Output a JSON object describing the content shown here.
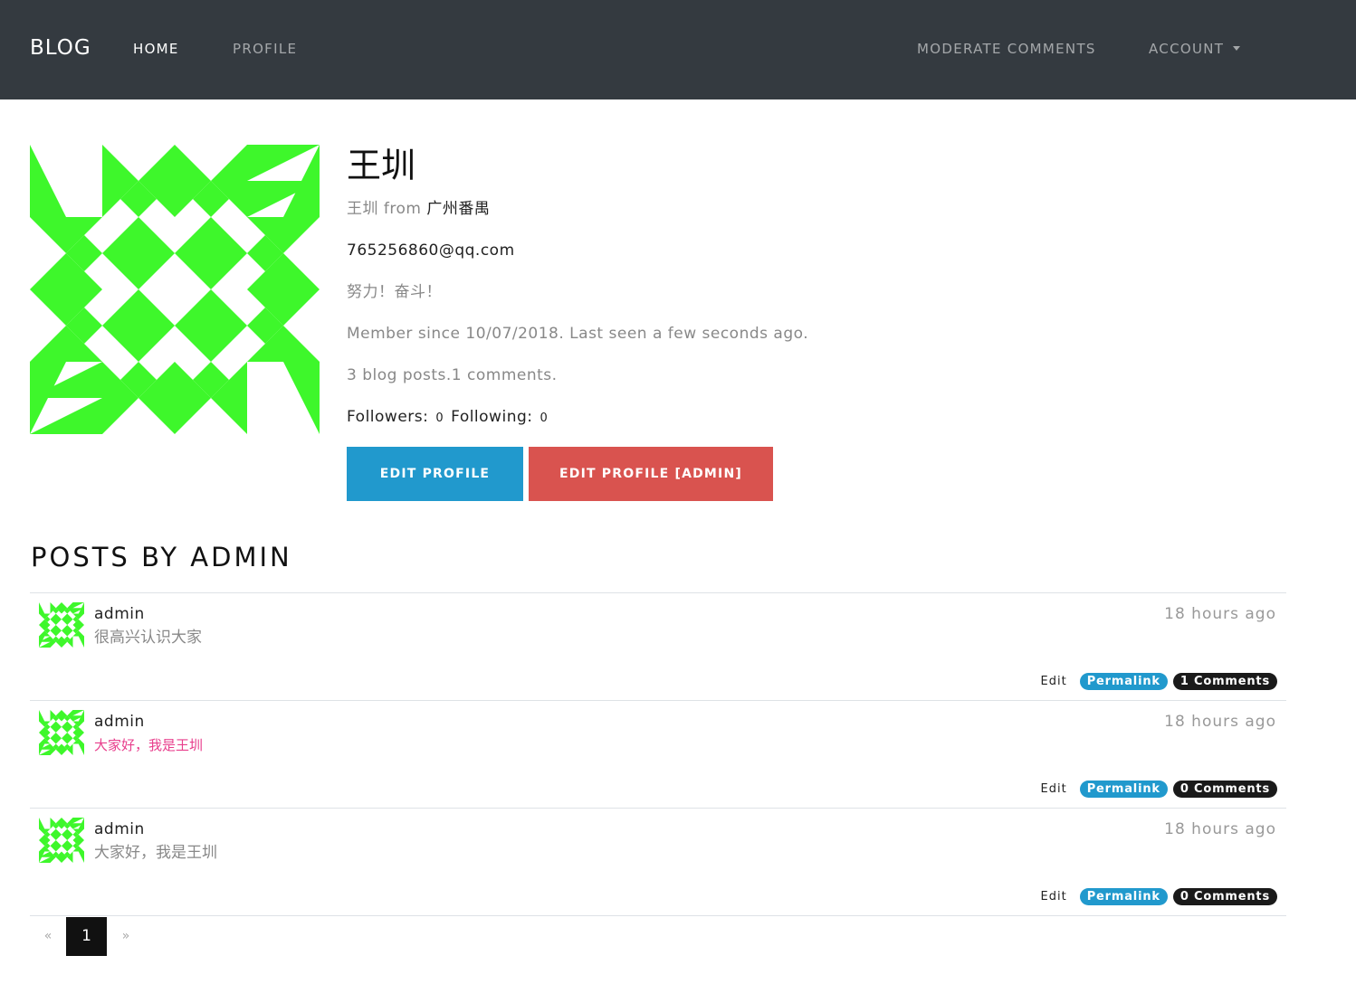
{
  "navbar": {
    "brand": "BLOG",
    "links": {
      "home": "HOME",
      "profile": "PROFILE",
      "moderate": "MODERATE COMMENTS",
      "account": "ACCOUNT"
    }
  },
  "profile": {
    "name": "王圳",
    "from_name": "王圳",
    "from_word": "from",
    "location": "广州番禺",
    "email": "765256860@qq.com",
    "about": "努力！奋斗！",
    "member_since": "Member since 10/07/2018. Last seen a few seconds ago.",
    "counts": "3 blog posts.1 comments.",
    "followers_label": "Followers:",
    "followers": "0",
    "following_label": "Following:",
    "following": "0",
    "buttons": {
      "edit": "EDIT PROFILE",
      "edit_admin": "EDIT PROFILE [ADMIN]"
    },
    "avatar_color": "#3ef72b"
  },
  "posts_section": {
    "title": "POSTS BY ADMIN"
  },
  "posts": [
    {
      "author": "admin",
      "time": "18 hours ago",
      "body": "很高兴认识大家",
      "edit": "Edit",
      "permalink": "Permalink",
      "comments": "1 Comments"
    },
    {
      "author": "admin",
      "time": "18 hours ago",
      "body": "大家好，我是王圳",
      "edit": "Edit",
      "permalink": "Permalink",
      "comments": "0 Comments"
    },
    {
      "author": "admin",
      "time": "18 hours ago",
      "body": "大家好，我是王圳",
      "edit": "Edit",
      "permalink": "Permalink",
      "comments": "0 Comments"
    }
  ],
  "pagination": {
    "prev": "«",
    "current": "1",
    "next": "»"
  },
  "colors": {
    "navbar": "#343a40",
    "primary": "#2199cd",
    "danger": "#d9534f",
    "code_text": "#e83e8c",
    "avatar_green": "#3ef72b"
  }
}
